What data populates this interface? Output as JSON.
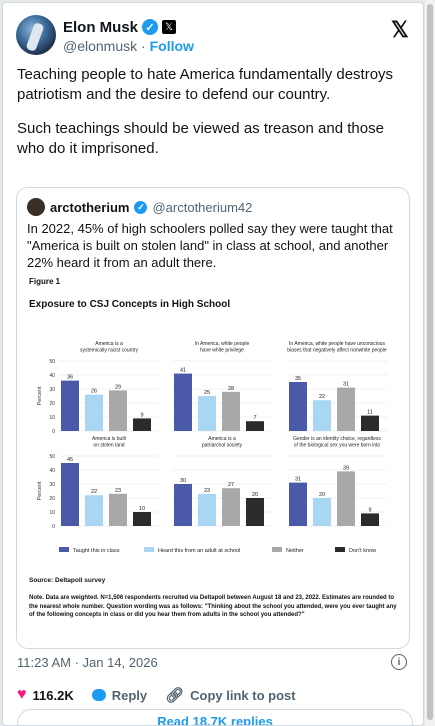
{
  "author": {
    "name": "Elon Musk",
    "handle": "@elonmusk",
    "follow_label": "Follow",
    "separator": "·",
    "platform_badge": "𝕏"
  },
  "x_logo": "𝕏",
  "tweet": {
    "paragraphs": [
      "Teaching people to hate America fundamentally destroys patriotism and the desire to defend our country.",
      "Such teachings should be viewed as treason and those who do it imprisoned."
    ]
  },
  "quote": {
    "name": "arctotherium",
    "handle": "@arctotherium42",
    "text": "In 2022, 45% of high schoolers polled say they were taught that \"America is built on stolen land\" in class at school, and another 22% heard it from an adult there.",
    "figure": {
      "label": "Figure 1",
      "title": "Exposure to CSJ Concepts in High School",
      "source": "Source: Deltapoll survey",
      "note": "Note. Data are weighted. N=1,506 respondents recruited via Deltapoll between August 18 and 23, 2022. Estimates are rounded to the nearest whole number. Question wording was as follows: \"Thinking about the school you attended, were you ever taught any of the following concepts in class or did you hear them from adults in the school you attended?\""
    }
  },
  "chart_data": {
    "type": "bar",
    "ylabel": "Percent",
    "ylim": [
      0,
      50
    ],
    "yticks": [
      "0",
      "10",
      "20",
      "30",
      "40",
      "50"
    ],
    "series_names": [
      "Taught this in class",
      "Heard this from an adult at school",
      "Neither",
      "Don't know"
    ],
    "colors": [
      "#4a5aa8",
      "#a9d6f2",
      "#a8a8a8",
      "#2b2b2b"
    ],
    "panels": [
      {
        "title": [
          "America is a",
          "systemically racist country"
        ],
        "values": [
          36,
          26,
          29,
          9
        ]
      },
      {
        "title": [
          "In America, white people",
          "have white privilege"
        ],
        "values": [
          41,
          25,
          28,
          7
        ]
      },
      {
        "title": [
          "In America, white people have unconscious",
          "biases that negatively affect nonwhite people"
        ],
        "values": [
          35,
          22,
          31,
          11
        ]
      },
      {
        "title": [
          "America is built",
          "on stolen land"
        ],
        "values": [
          45,
          22,
          23,
          10
        ]
      },
      {
        "title": [
          "America is a",
          "patriarchal society"
        ],
        "values": [
          30,
          23,
          27,
          20
        ]
      },
      {
        "title": [
          "Gender is an identity choice, regardless",
          "of the biological sex you were born into"
        ],
        "values": [
          31,
          20,
          39,
          9
        ]
      }
    ]
  },
  "footer": {
    "timestamp": "11:23 AM · Jan 14, 2026",
    "info_icon": "i",
    "likes": "116.2K",
    "reply_label": "Reply",
    "copy_link_label": "Copy link to post",
    "read_replies_label": "Read 18.7K replies"
  },
  "colors": {
    "accent": "#1d9bf0",
    "like": "#f91880"
  }
}
